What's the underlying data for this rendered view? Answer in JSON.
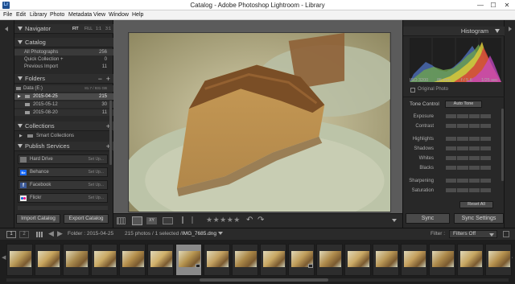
{
  "window": {
    "title": "Catalog - Adobe Photoshop Lightroom - Library",
    "minimize": "—",
    "maximize": "☐",
    "close": "✕",
    "icon_letters": "Lr"
  },
  "menu": [
    "File",
    "Edit",
    "Library",
    "Photo",
    "Metadata",
    "View",
    "Window",
    "Help"
  ],
  "navigator": {
    "title": "Navigator",
    "zoom_options": [
      "FIT",
      "FILL",
      "1:1",
      "3:1"
    ]
  },
  "catalog": {
    "title": "Catalog",
    "items": [
      {
        "label": "All Photographs",
        "count": "256"
      },
      {
        "label": "Quick Collection +",
        "count": "0"
      },
      {
        "label": "Previous Import",
        "count": "11"
      }
    ]
  },
  "folders": {
    "title": "Folders",
    "volume": {
      "label": "Data (E:)",
      "stats": "81.7 / 931 GB"
    },
    "items": [
      {
        "label": "2015-04-25",
        "count": "215"
      },
      {
        "label": "2015-05-12",
        "count": "30"
      },
      {
        "label": "2015-08-20",
        "count": "11"
      }
    ]
  },
  "collections": {
    "title": "Collections",
    "items": [
      {
        "label": "Smart Collections"
      }
    ]
  },
  "publish_services": {
    "title": "Publish Services",
    "items": [
      {
        "label": "Hard Drive",
        "action": "Set Up..."
      },
      {
        "label": "Behance",
        "action": "Set Up..."
      },
      {
        "label": "Facebook",
        "action": "Set Up..."
      },
      {
        "label": "Flickr",
        "action": "Set Up..."
      }
    ]
  },
  "left_buttons": {
    "import": "Import Catalog",
    "export": "Export Catalog"
  },
  "histogram": {
    "title": "Histogram",
    "iso": "ISO 3200",
    "focal": "85 mm",
    "aperture": "f / 5.6",
    "shutter": "1/25 sec",
    "original_photo": "Original Photo"
  },
  "quick_develop": {
    "tone_control": "Tone Control",
    "auto_tone": "Auto Tone",
    "rows": [
      "Exposure",
      "Contrast",
      "Highlights",
      "Shadows",
      "Whites",
      "Blacks",
      "Sharpening",
      "Saturation",
      "Vibrance"
    ],
    "reset_all": "Reset All"
  },
  "sync": {
    "sync": "Sync",
    "sync_settings": "Sync Settings"
  },
  "toolbar": {
    "rating": "★★★★★"
  },
  "filmstrip_bar": {
    "page1": "1",
    "page2": "2",
    "folder": "Folder : 2015-04-25",
    "info": "215 photos / 1 selected /",
    "filename": "IMG_7685.dng",
    "filter_label": "Filter :",
    "filter_value": "Filters Off"
  },
  "colors": {
    "panel_bg": "#282828",
    "center_bg": "#5b5b5b",
    "selected_row": "#4a4a4a",
    "accent_blue": "#1f4f8f"
  }
}
